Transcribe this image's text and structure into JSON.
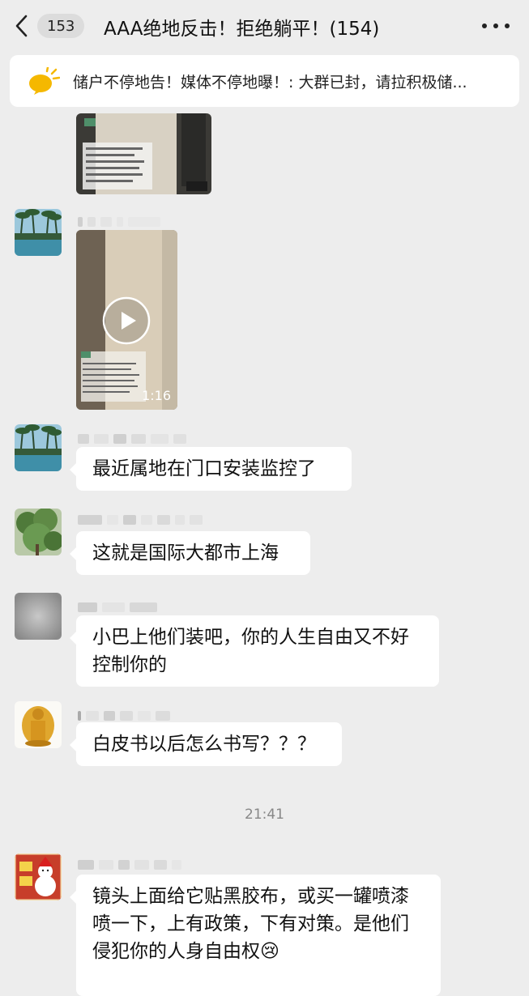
{
  "header": {
    "back_count": "153",
    "title": "AAA绝地反击！拒绝躺平！(154)"
  },
  "notice": {
    "text": "储户不停地告！媒体不停地曝！: 大群已封，请拉积极储..."
  },
  "video": {
    "duration": "1:16"
  },
  "messages": [
    {
      "text": "最近属地在门口安装监控了"
    },
    {
      "text": "这就是国际大都市上海"
    },
    {
      "text": "小巴上他们装吧，你的人生自由又不好控制你的"
    },
    {
      "text": "白皮书以后怎么书写？？？"
    },
    {
      "text": "镜头上面给它贴黑胶布，或买一罐喷漆喷一下，上有政策，下有对策。是他们侵犯你的人身自由权😢"
    }
  ],
  "timestamp": "21:41",
  "colors": {
    "background": "#ededed",
    "bubble": "#ffffff",
    "notice_icon": "#f5b800"
  },
  "icons": [
    "chevron-left-icon",
    "more-icon",
    "announcement-icon",
    "play-icon"
  ]
}
